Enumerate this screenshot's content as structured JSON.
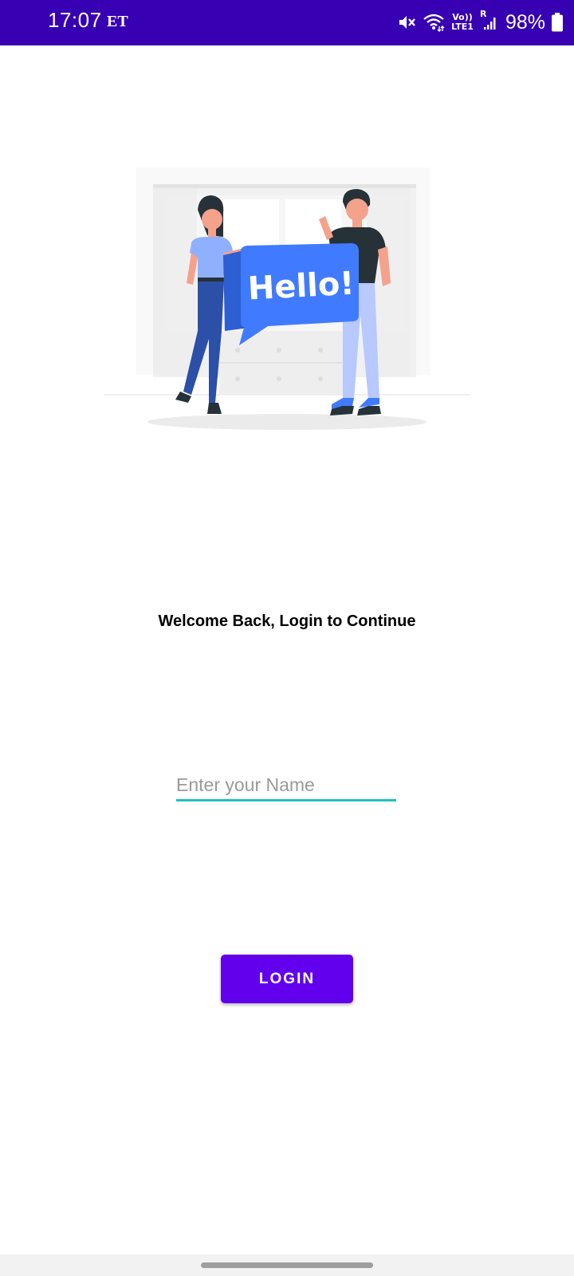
{
  "status_bar": {
    "time": "17:07",
    "carrier": "ET",
    "volte_top": "Vo))",
    "volte_bottom": "LTE1",
    "roaming": "R",
    "battery_percent": "98%",
    "background_color": "#3700b3",
    "icons": [
      "mute-icon",
      "wifi-icon",
      "volte-icon",
      "signal-icon",
      "battery-icon"
    ]
  },
  "illustration": {
    "speech_bubble_text": "Hello!",
    "icon": "people-greeting-illustration",
    "accent_color": "#407bff"
  },
  "main": {
    "welcome_text": "Welcome Back, Login to Continue"
  },
  "form": {
    "name_placeholder": "Enter your Name",
    "name_value": "",
    "underline_color": "#1fc2bd"
  },
  "actions": {
    "login_label": "LOGIN",
    "button_color": "#6200ee"
  }
}
